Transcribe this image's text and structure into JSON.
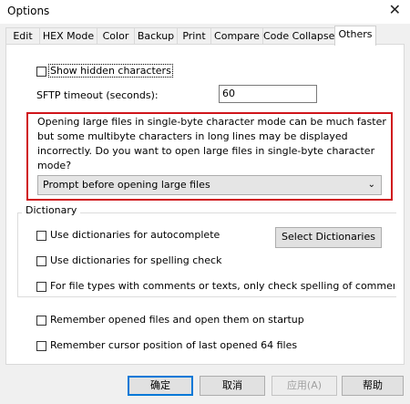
{
  "window": {
    "title": "Options",
    "close_glyph": "✕"
  },
  "tabs": [
    "Edit",
    "HEX Mode",
    "Color",
    "Backup",
    "Print",
    "Compare",
    "Code Collapse",
    "Others"
  ],
  "active_tab": "Others",
  "others": {
    "show_hidden_characters": {
      "label": "Show hidden characters",
      "checked": false
    },
    "sftp_timeout": {
      "label": "SFTP timeout (seconds):",
      "value": "60"
    },
    "large_files": {
      "message": "Opening large files in single-byte character mode can be much faster but some multibyte characters in long lines may be displayed incorrectly. Do you want to open large files in single-byte character mode?",
      "selected": "Prompt before opening large files"
    },
    "dictionary": {
      "title": "Dictionary",
      "autocomplete": {
        "label": "Use dictionaries for autocomplete",
        "checked": false
      },
      "spelling": {
        "label": "Use dictionaries for spelling check",
        "checked": false
      },
      "comments_only": {
        "label": "For file types with comments or texts, only check spelling of comments and tex",
        "checked": false
      },
      "select_button": "Select Dictionaries"
    },
    "remember_files": {
      "label": "Remember opened files and open them on startup",
      "checked": false
    },
    "remember_cursor": {
      "label": "Remember cursor position of last opened 64 files",
      "checked": false
    }
  },
  "footer": {
    "ok": "确定",
    "cancel": "取消",
    "apply": "应用(A)",
    "help": "帮助"
  }
}
